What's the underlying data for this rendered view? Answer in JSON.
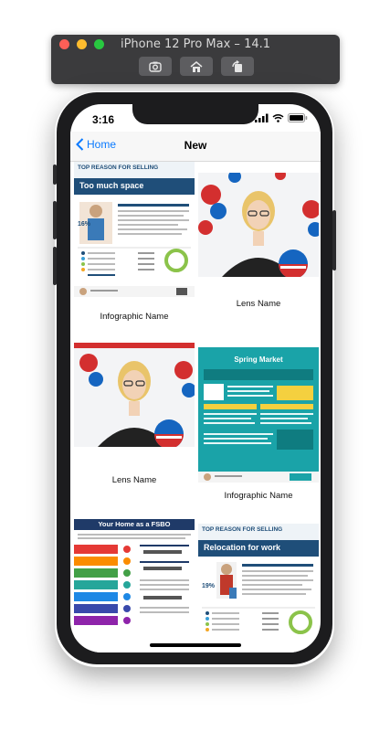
{
  "simulator": {
    "title": "iPhone 12 Pro Max – 14.1"
  },
  "status_bar": {
    "time": "3:16"
  },
  "nav": {
    "back_label": "Home",
    "title": "New"
  },
  "cards": [
    {
      "caption": "Infographic Name",
      "type": "infographic",
      "heading": "TOP REASON FOR SELLING",
      "subheading": "Too much space"
    },
    {
      "caption": "Lens Name",
      "type": "lens"
    },
    {
      "caption": "Lens Name",
      "type": "lens"
    },
    {
      "caption": "Infographic Name",
      "type": "infographic",
      "heading": "Spring Market"
    },
    {
      "caption": "",
      "type": "infographic",
      "heading": "Your Home as a FSBO"
    },
    {
      "caption": "",
      "type": "infographic",
      "heading": "TOP REASON FOR SELLING",
      "subheading": "Relocation for work"
    }
  ],
  "colors": {
    "ios_blue": "#0a7aff",
    "navy": "#1f4e79",
    "teal": "#1aa3a8",
    "red": "#d32f2f"
  }
}
